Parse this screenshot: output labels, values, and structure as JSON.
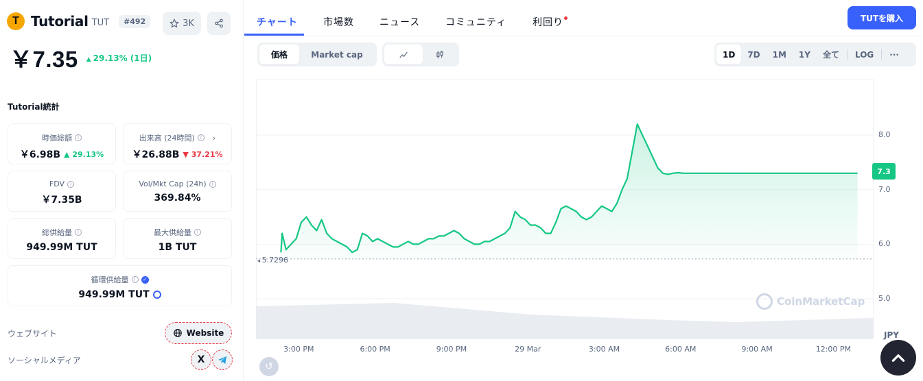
{
  "coin": {
    "logo_letter": "T",
    "name": "Tutorial",
    "symbol": "TUT",
    "rank": "#492",
    "watchlist_count": "3K",
    "price": "￥7.35",
    "change_arrow": "▲",
    "change": "29.13% (1日)"
  },
  "stats": {
    "title": "Tutorial統計",
    "market_cap": {
      "label": "時価総額",
      "value": "￥6.98B",
      "change": "29.13%",
      "direction": "up"
    },
    "volume": {
      "label": "出来高 (24時間)",
      "value": "￥26.88B",
      "change": "37.21%",
      "direction": "down"
    },
    "fdv": {
      "label": "FDV",
      "value": "￥7.35B"
    },
    "vol_mkt_cap": {
      "label": "Vol/Mkt Cap (24h)",
      "value": "369.84%"
    },
    "total_supply": {
      "label": "総供給量",
      "value": "949.99M TUT"
    },
    "max_supply": {
      "label": "最大供給量",
      "value": "1B TUT"
    },
    "circulating_supply": {
      "label": "循環供給量",
      "value": "949.99M TUT"
    }
  },
  "links": {
    "website_label": "ウェブサイト",
    "website_button": "Website",
    "social_label": "ソーシャルメディア",
    "x_glyph": "X"
  },
  "tabs": [
    {
      "label": "チャート",
      "active": true
    },
    {
      "label": "市場数",
      "active": false
    },
    {
      "label": "ニュース",
      "active": false
    },
    {
      "label": "コミュニティ",
      "active": false
    },
    {
      "label": "利回り",
      "active": false,
      "has_dot": true
    }
  ],
  "buy_button": "TUTを購入",
  "chart_mode": {
    "price": "価格",
    "market_cap": "Market cap",
    "selected": "価格"
  },
  "chart_style": {
    "selected": "line"
  },
  "ranges": {
    "items": [
      "1D",
      "7D",
      "1M",
      "1Y",
      "全て"
    ],
    "selected": "1D",
    "log": "LOG",
    "more": "···"
  },
  "colors": {
    "up": "#16c784",
    "down": "#ea3943",
    "accent": "#3861fb"
  },
  "chart_data": {
    "type": "line",
    "currency": "JPY",
    "y_ticks": [
      "8.0",
      "7.0",
      "6.0",
      "5.0"
    ],
    "ylim": [
      4.26,
      9.03
    ],
    "x_ticks": [
      "3:00 PM",
      "6:00 PM",
      "9:00 PM",
      "29 Mar",
      "3:00 AM",
      "6:00 AM",
      "9:00 AM",
      "12:00 PM"
    ],
    "x_tick_hours": [
      3,
      6,
      9,
      12,
      15,
      18,
      21,
      24
    ],
    "xlim_hours": [
      1.32,
      25.58
    ],
    "baseline": 5.7296,
    "baseline_label": "5.7296",
    "current_value": "7.3",
    "watermark": "CoinMarketCap",
    "series": [
      {
        "x": [
          2.3,
          2.35,
          2.5,
          2.7,
          2.9,
          3.1,
          3.3,
          3.5,
          3.7,
          3.9,
          4.1,
          4.3,
          4.5,
          4.7,
          4.9,
          5.1,
          5.3,
          5.5,
          5.7,
          5.9,
          6.1,
          6.3,
          6.5,
          6.7,
          6.9,
          7.1,
          7.3,
          7.5,
          7.7,
          7.9,
          8.1,
          8.3,
          8.5,
          8.7,
          8.9,
          9.1,
          9.3,
          9.5,
          9.7,
          9.9,
          10.1,
          10.3,
          10.5,
          10.7,
          10.9,
          11.1,
          11.3,
          11.5,
          11.7,
          11.9,
          12.1,
          12.3,
          12.5,
          12.7,
          12.9,
          13.1,
          13.3,
          13.5,
          13.7,
          13.9,
          14.1,
          14.3,
          14.5,
          14.7,
          14.9,
          15.1,
          15.3,
          15.5,
          15.7,
          15.9,
          16.1,
          16.3,
          16.5,
          16.7,
          16.9,
          17.1,
          17.3,
          17.5,
          17.7,
          17.9,
          18.1,
          18.3,
          18.5,
          18.7,
          18.9,
          19.1,
          19.3,
          19.5,
          19.7,
          19.9,
          20.1,
          20.3,
          20.5,
          20.7,
          20.9,
          21.1,
          21.3,
          21.5,
          21.7,
          21.9,
          22.1,
          22.3,
          22.5,
          22.7,
          22.9,
          23.1,
          23.3,
          23.5,
          23.7,
          23.8,
          23.9,
          24.0,
          24.2,
          24.4,
          24.6,
          24.8,
          24.95
        ],
        "y": [
          5.85,
          6.2,
          5.9,
          6.0,
          6.1,
          6.4,
          6.5,
          6.35,
          6.25,
          6.45,
          6.2,
          6.1,
          6.05,
          6.0,
          5.95,
          5.85,
          5.9,
          6.2,
          6.15,
          6.05,
          6.1,
          6.05,
          6.0,
          5.95,
          5.95,
          6.0,
          6.05,
          6.0,
          6.0,
          6.05,
          6.1,
          6.1,
          6.15,
          6.15,
          6.2,
          6.25,
          6.2,
          6.1,
          6.05,
          6.0,
          6.0,
          6.05,
          6.05,
          6.1,
          6.15,
          6.2,
          6.3,
          6.6,
          6.5,
          6.45,
          6.35,
          6.35,
          6.3,
          6.2,
          6.2,
          6.4,
          6.65,
          6.7,
          6.65,
          6.6,
          6.5,
          6.45,
          6.5,
          6.6,
          6.7,
          6.65,
          6.6,
          6.75,
          7.0,
          7.2,
          7.7,
          8.2,
          8.0,
          7.8,
          7.6,
          7.4,
          7.3,
          7.28,
          7.3,
          7.31,
          7.3,
          7.3,
          7.3,
          7.3,
          7.3,
          7.3,
          7.3,
          7.3,
          7.3,
          7.3,
          7.3,
          7.3,
          7.3,
          7.3,
          7.3,
          7.3,
          7.3,
          7.3,
          7.3,
          7.3,
          7.3,
          7.3,
          7.3,
          7.3,
          7.3,
          7.3,
          7.3,
          7.3,
          7.3,
          7.3,
          7.3,
          7.3,
          7.3,
          7.3,
          7.3,
          7.3,
          7.3
        ]
      }
    ]
  }
}
